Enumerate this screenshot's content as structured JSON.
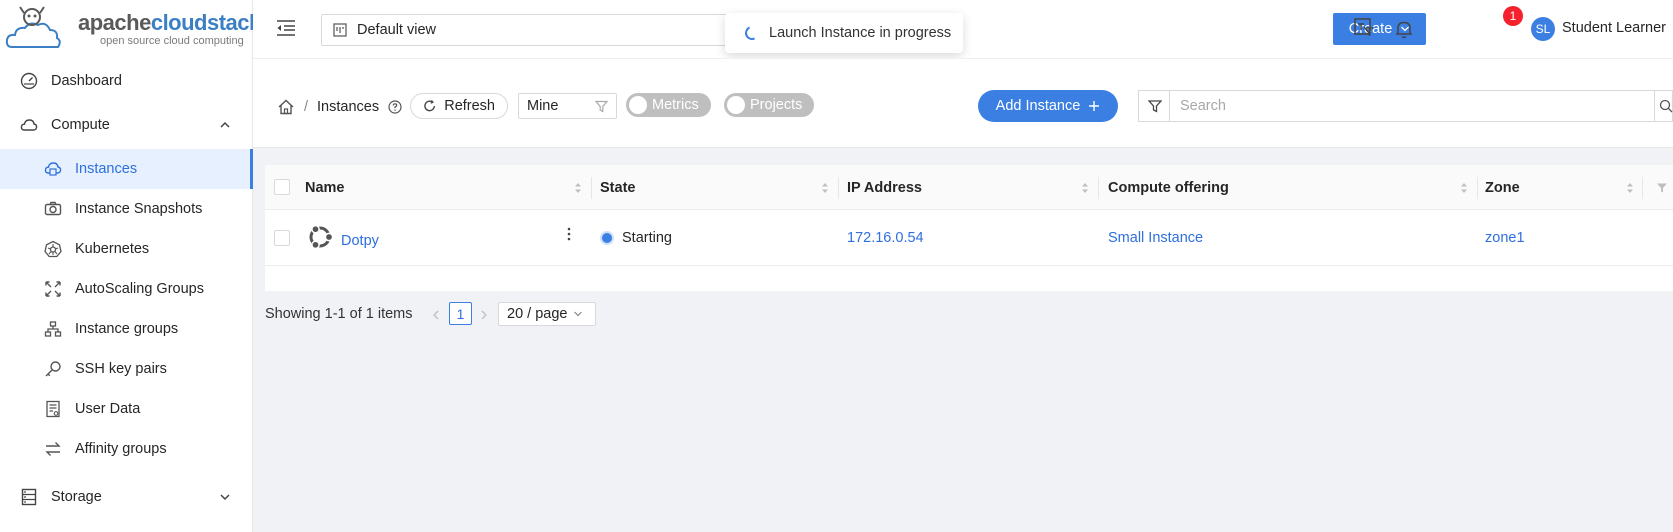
{
  "logo": {
    "brand_a": "apache",
    "brand_b": "cloudstack",
    "tagline": "open source cloud computing"
  },
  "sidebar": {
    "items": [
      {
        "label": "Dashboard",
        "icon": "dashboard-icon"
      },
      {
        "label": "Compute",
        "icon": "cloud-icon",
        "expanded": true
      },
      {
        "label": "Instances",
        "icon": "cloud-server-icon",
        "active": true
      },
      {
        "label": "Instance Snapshots",
        "icon": "camera-icon"
      },
      {
        "label": "Kubernetes",
        "icon": "kubernetes-icon"
      },
      {
        "label": "AutoScaling Groups",
        "icon": "expand-arrows-icon"
      },
      {
        "label": "Instance groups",
        "icon": "cluster-icon"
      },
      {
        "label": "SSH key pairs",
        "icon": "key-icon"
      },
      {
        "label": "User Data",
        "icon": "document-icon"
      },
      {
        "label": "Affinity groups",
        "icon": "swap-icon"
      },
      {
        "label": "Storage",
        "icon": "database-icon",
        "expanded": false
      }
    ]
  },
  "header": {
    "view_select": "Default view",
    "toast": "Launch Instance in progress",
    "create_label": "Create",
    "notification_count": "1",
    "avatar_initials": "SL",
    "username": "Student Learner"
  },
  "toolbar": {
    "breadcrumb_page": "Instances",
    "refresh_label": "Refresh",
    "filter_select": "Mine",
    "metrics_label": "Metrics",
    "projects_label": "Projects",
    "add_label": "Add Instance",
    "search_placeholder": "Search"
  },
  "table": {
    "columns": [
      "Name",
      "State",
      "IP Address",
      "Compute offering",
      "Zone"
    ],
    "rows": [
      {
        "name": "Dotpy",
        "state": "Starting",
        "ip": "172.16.0.54",
        "offering": "Small Instance",
        "zone": "zone1"
      }
    ]
  },
  "pagination": {
    "summary": "Showing 1-1 of 1 items",
    "current_page": "1",
    "page_size": "20 / page"
  },
  "colors": {
    "primary": "#3b7fe3",
    "badge": "#f5222d",
    "toggle_off": "#bfbfbf"
  }
}
